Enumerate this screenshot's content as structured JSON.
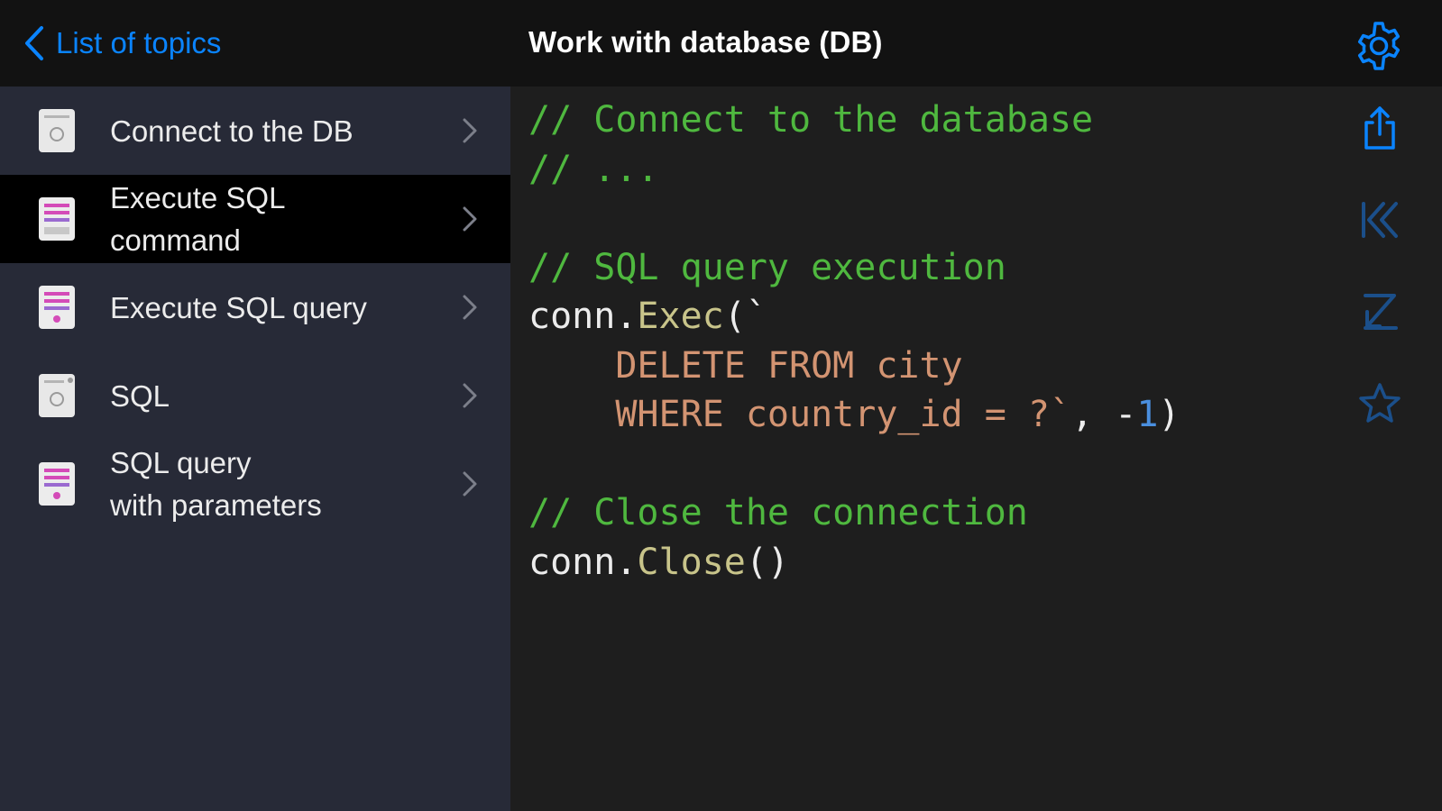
{
  "header": {
    "back_label": "List of topics",
    "title": "Work with database (DB)",
    "settings_icon": "gear-icon"
  },
  "sidebar": {
    "items": [
      {
        "label": "Connect to the DB",
        "icon": "document-icon",
        "selected": false
      },
      {
        "label": "Execute SQL\ncommand",
        "icon": "code-document-icon",
        "selected": true
      },
      {
        "label": "Execute SQL query",
        "icon": "code-document-icon",
        "selected": false
      },
      {
        "label": "SQL",
        "icon": "document-icon",
        "selected": false
      },
      {
        "label": "SQL query\nwith parameters",
        "icon": "code-document-icon",
        "selected": false
      }
    ]
  },
  "code": {
    "line1_comment": "// Connect to the database",
    "line2_comment": "// ...",
    "line4_comment": "// SQL query execution",
    "line5_ident": "conn.",
    "line5_func": "Exec",
    "line5_rest": "(`",
    "line6_str": "    DELETE FROM city",
    "line7_str": "    WHERE country_id = ?`",
    "line7_rest": ", -",
    "line7_num": "1",
    "line7_end": ")",
    "line9_comment": "// Close the connection",
    "line10_ident": "conn.",
    "line10_func": "Close",
    "line10_rest": "()"
  },
  "actions": {
    "share_icon": "share-icon",
    "first_icon": "jump-to-first-icon",
    "last_icon": "jump-to-last-icon",
    "favorite_icon": "star-icon"
  },
  "colors": {
    "accent": "#0a84ff",
    "dim_accent": "#1b4f8a",
    "comment": "#4fb83f",
    "string": "#d39472",
    "number": "#4a8fdf",
    "function": "#c8c48a"
  }
}
